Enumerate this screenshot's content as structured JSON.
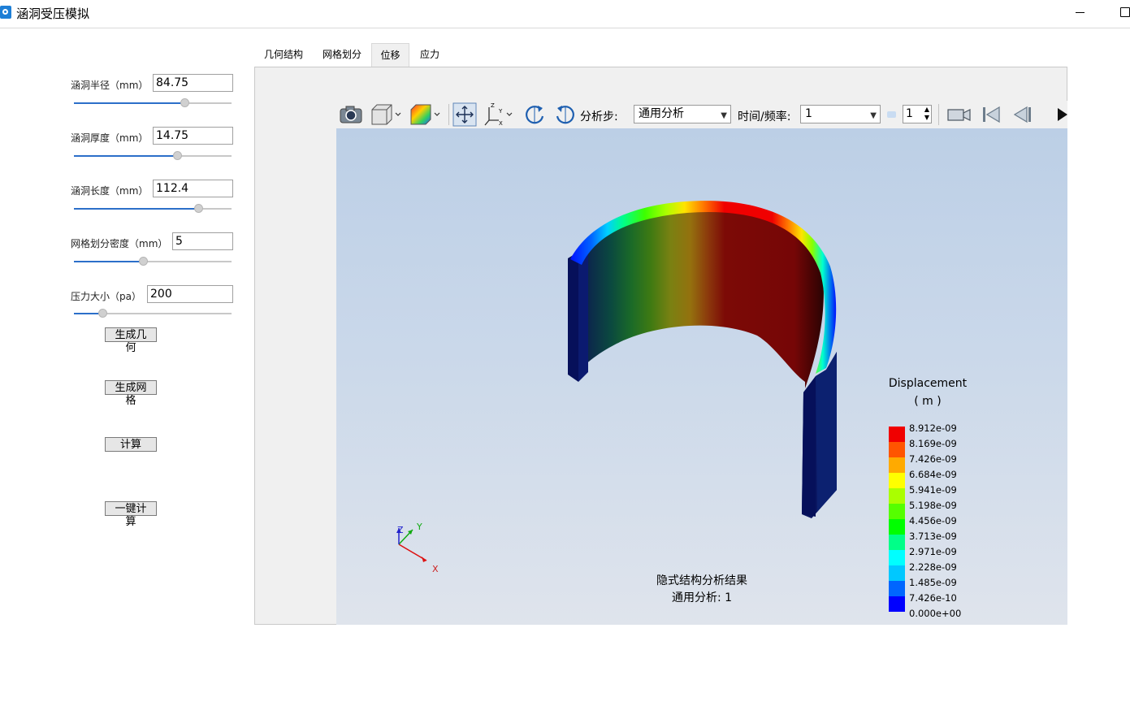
{
  "window": {
    "title": "涵洞受压模拟",
    "app_icon": "app-logo-icon",
    "minimize_icon": "minimize-icon",
    "maximize_icon": "maximize-icon"
  },
  "params": [
    {
      "label": "涵洞半径（mm）",
      "value": "84.75",
      "slider_fraction": 0.7
    },
    {
      "label": "涵洞厚度（mm）",
      "value": "14.75",
      "slider_fraction": 0.66
    },
    {
      "label": "涵洞长度（mm）",
      "value": "112.4",
      "slider_fraction": 0.79
    },
    {
      "label": "网格划分密度（mm）",
      "value": "5",
      "slider_fraction": 0.44
    },
    {
      "label": "压力大小（pa）",
      "value": "200",
      "slider_fraction": 0.18
    }
  ],
  "buttons": {
    "generate_geometry": "生成几何",
    "generate_mesh": "生成网格",
    "compute": "计算",
    "one_click_compute": "一键计算"
  },
  "tabs": [
    {
      "label": "几何结构",
      "active": false
    },
    {
      "label": "网格划分",
      "active": false
    },
    {
      "label": "位移",
      "active": true
    },
    {
      "label": "应力",
      "active": false
    }
  ],
  "toolbar": {
    "step_label": "分析步:",
    "step_value": "通用分析",
    "time_label": "时间/频率:",
    "time_value": "1",
    "frame_value": "1",
    "icons": [
      "camera-icon",
      "view-cube-icon",
      "render-mode-icon",
      "pan-icon",
      "axis-orient-icon",
      "rotate-ccw-icon",
      "rotate-cw-icon",
      "record-video-icon",
      "first-frame-icon",
      "previous-frame-icon",
      "next-frame-icon"
    ]
  },
  "viewport": {
    "caption_line1": "隐式结构分析结果",
    "caption_line2": "通用分析: 1",
    "axis_labels": {
      "x": "X",
      "y": "Y",
      "z": "Z"
    }
  },
  "legend": {
    "title": "Displacement",
    "unit": "( m )",
    "labels": [
      "8.912e-09",
      "8.169e-09",
      "7.426e-09",
      "6.684e-09",
      "5.941e-09",
      "5.198e-09",
      "4.456e-09",
      "3.713e-09",
      "2.971e-09",
      "2.228e-09",
      "1.485e-09",
      "7.426e-10",
      "0.000e+00"
    ],
    "colors": [
      "#f00000",
      "#ff5500",
      "#ffaa00",
      "#ffff00",
      "#aaff00",
      "#55ff00",
      "#00ff00",
      "#00ff88",
      "#00ffff",
      "#00c8ff",
      "#0066ff",
      "#0000ff"
    ]
  }
}
